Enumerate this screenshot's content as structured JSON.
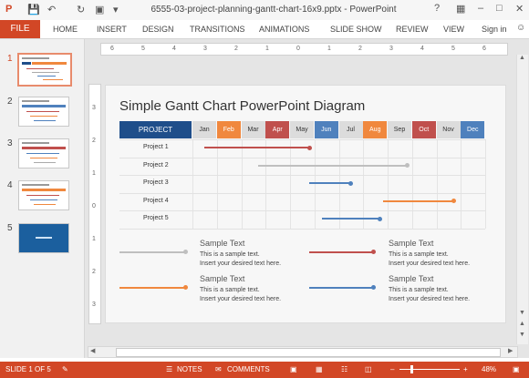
{
  "window": {
    "title": "6555-03-project-planning-gantt-chart-16x9.pptx - PowerPoint"
  },
  "colors": {
    "accent": "#d24726",
    "project_header": "#1f4e8a"
  },
  "ribbon": {
    "file_label": "FILE",
    "tabs": [
      "HOME",
      "INSERT",
      "DESIGN",
      "TRANSITIONS",
      "ANIMATIONS",
      "SLIDE SHOW",
      "REVIEW",
      "VIEW"
    ],
    "sign_in": "Sign in"
  },
  "ruler": {
    "h": [
      "6",
      "5",
      "4",
      "3",
      "2",
      "1",
      "0",
      "1",
      "2",
      "3",
      "4",
      "5",
      "6"
    ],
    "v": [
      "3",
      "2",
      "1",
      "0",
      "1",
      "2",
      "3"
    ]
  },
  "slides": [
    "1",
    "2",
    "3",
    "4",
    "5"
  ],
  "slide": {
    "title": "Simple Gantt Chart PowerPoint Diagram",
    "project_header": "PROJECT",
    "months": [
      {
        "label": "Jan",
        "bg": "#dcdcdc",
        "fg": "#333333"
      },
      {
        "label": "Feb",
        "bg": "#f0883e",
        "fg": "#ffffff"
      },
      {
        "label": "Mar",
        "bg": "#dcdcdc",
        "fg": "#333333"
      },
      {
        "label": "Apr",
        "bg": "#c0504d",
        "fg": "#ffffff"
      },
      {
        "label": "May",
        "bg": "#dcdcdc",
        "fg": "#333333"
      },
      {
        "label": "Jun",
        "bg": "#4f81bd",
        "fg": "#ffffff"
      },
      {
        "label": "Jul",
        "bg": "#dcdcdc",
        "fg": "#333333"
      },
      {
        "label": "Aug",
        "bg": "#f0883e",
        "fg": "#ffffff"
      },
      {
        "label": "Sep",
        "bg": "#dcdcdc",
        "fg": "#333333"
      },
      {
        "label": "Oct",
        "bg": "#c0504d",
        "fg": "#ffffff"
      },
      {
        "label": "Nov",
        "bg": "#dcdcdc",
        "fg": "#333333"
      },
      {
        "label": "Dec",
        "bg": "#4f81bd",
        "fg": "#ffffff"
      }
    ],
    "projects": [
      {
        "label": "Project 1",
        "start_month": 0.5,
        "end_month": 4.8,
        "color": "#c0504d"
      },
      {
        "label": "Project 2",
        "start_month": 2.7,
        "end_month": 8.8,
        "color": "#bfbfbf"
      },
      {
        "label": "Project 3",
        "start_month": 4.8,
        "end_month": 6.5,
        "color": "#4f81bd"
      },
      {
        "label": "Project 4",
        "start_month": 7.8,
        "end_month": 10.7,
        "color": "#f0883e"
      },
      {
        "label": "Project 5",
        "start_month": 5.3,
        "end_month": 7.7,
        "color": "#4f81bd"
      }
    ],
    "legend": [
      {
        "head": "Sample Text",
        "line1": "This is a sample text.",
        "line2": "Insert your desired text here.",
        "color": "#bfbfbf"
      },
      {
        "head": "Sample Text",
        "line1": "This is a sample text.",
        "line2": "Insert your desired text here.",
        "color": "#c0504d"
      },
      {
        "head": "Sample Text",
        "line1": "This is a sample text.",
        "line2": "Insert your desired text here.",
        "color": "#f0883e"
      },
      {
        "head": "Sample Text",
        "line1": "This is a sample text.",
        "line2": "Insert your desired text here.",
        "color": "#4f81bd"
      }
    ]
  },
  "status": {
    "slide_of": "SLIDE 1 OF 5",
    "notes": "NOTES",
    "comments": "COMMENTS",
    "zoom": "48%"
  }
}
